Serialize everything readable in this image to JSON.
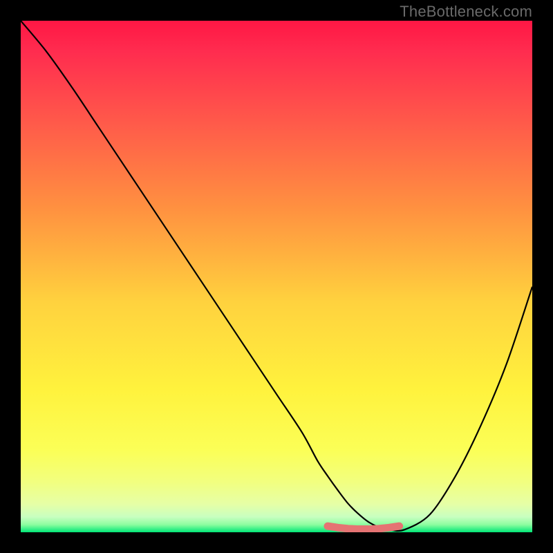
{
  "attribution": "TheBottleneck.com",
  "colors": {
    "gradient_stops": [
      {
        "offset": 0,
        "color": "#ff1744"
      },
      {
        "offset": 0.06,
        "color": "#ff2c4f"
      },
      {
        "offset": 0.2,
        "color": "#ff5a4a"
      },
      {
        "offset": 0.37,
        "color": "#ff9240"
      },
      {
        "offset": 0.55,
        "color": "#ffd23e"
      },
      {
        "offset": 0.72,
        "color": "#fff23d"
      },
      {
        "offset": 0.84,
        "color": "#fbff57"
      },
      {
        "offset": 0.9,
        "color": "#f2ff7e"
      },
      {
        "offset": 0.945,
        "color": "#e6ffa6"
      },
      {
        "offset": 0.97,
        "color": "#c8ffc0"
      },
      {
        "offset": 0.985,
        "color": "#8efda0"
      },
      {
        "offset": 1.0,
        "color": "#00e676"
      }
    ],
    "curve_stroke": "#000000",
    "marker_fill": "#e57373",
    "marker_stroke": "#cc5c5c"
  },
  "chart_data": {
    "type": "line",
    "title": "",
    "xlabel": "",
    "ylabel": "",
    "xlim": [
      0,
      100
    ],
    "ylim": [
      0,
      100
    ],
    "x": [
      0,
      5,
      10,
      15,
      20,
      25,
      30,
      35,
      40,
      45,
      50,
      55,
      58,
      60,
      62,
      64,
      66,
      68,
      70,
      72,
      75,
      80,
      85,
      90,
      95,
      100
    ],
    "series": [
      {
        "name": "bottleneck_curve",
        "values": [
          100,
          94,
          87,
          79.5,
          72,
          64.5,
          57,
          49.5,
          42,
          34.5,
          27,
          19.5,
          14,
          11,
          8.2,
          5.6,
          3.6,
          2.0,
          1.0,
          0.5,
          0.5,
          3.5,
          11,
          21,
          33,
          48
        ]
      }
    ],
    "valley_markers_x": [
      60,
      62,
      64,
      66,
      68,
      70,
      72,
      74
    ],
    "valley_markers_y": [
      1.2,
      0.9,
      0.7,
      0.6,
      0.6,
      0.7,
      0.9,
      1.2
    ]
  }
}
